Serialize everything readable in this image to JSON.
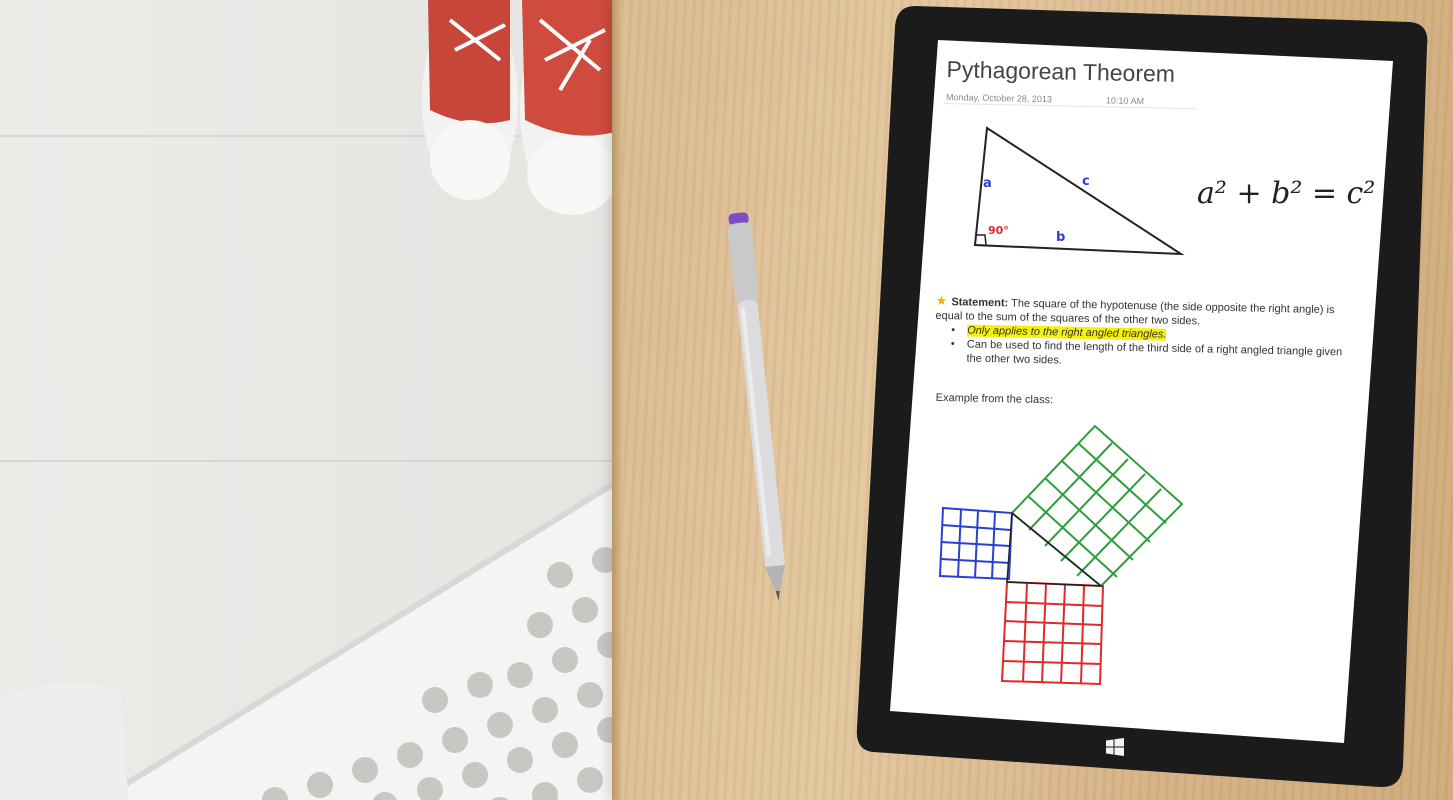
{
  "note": {
    "title": "Pythagorean Theorem",
    "date": "Monday, October 28, 2013",
    "time": "10:10 AM"
  },
  "diagram": {
    "side_a": "a",
    "side_b": "b",
    "side_c": "c",
    "angle": "90°",
    "formula": "a² + b² = c²"
  },
  "statement": {
    "label": "Statement:",
    "text": "The square of the hypotenuse (the side opposite the right angle) is equal to the sum of the  squares of the other two sides.",
    "bullets": [
      "Only applies to the right angled triangles.",
      "Can be used to find the length of the third side of a right angled triangle given the other two sides."
    ],
    "example_label": "Example from the class:"
  },
  "colors": {
    "ink_blue": "#2b3fd6",
    "ink_red": "#e02a2a",
    "ink_green": "#2f9e3a",
    "highlight": "#f4f20a",
    "star": "#f0b400"
  }
}
